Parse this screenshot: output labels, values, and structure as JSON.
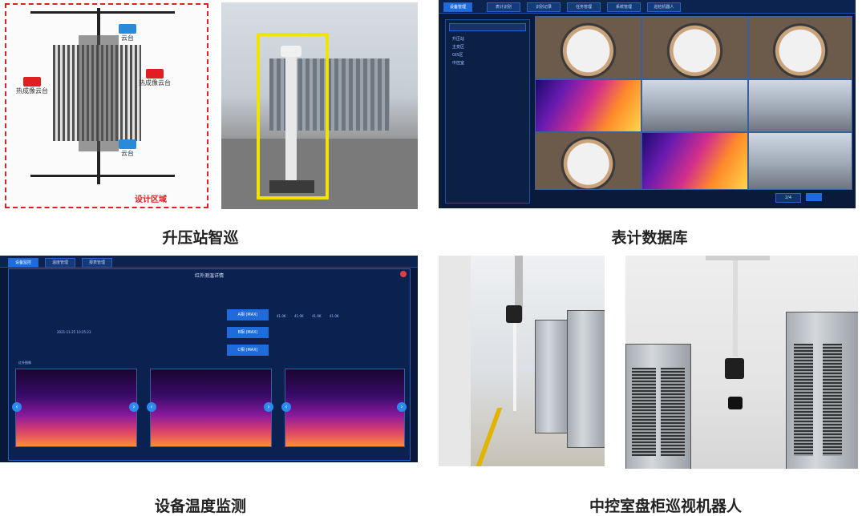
{
  "captions": {
    "booster": "升压站智巡",
    "meter_db": "表计数据库",
    "temp_monitor": "设备温度监测",
    "control_robot": "中控室盘柜巡视机器人"
  },
  "design_panel": {
    "region_label": "设计区域",
    "cam_label": "热成像云台",
    "cam_label_short": "云台"
  },
  "meter_panel": {
    "tabs": [
      "设备管理",
      "表计识别",
      "识别记录",
      "任务管理",
      "系统管理",
      "巡检机器人"
    ],
    "tree": [
      "升压站",
      "主变区",
      "GIS区",
      "中控室"
    ],
    "footer_value": "2/4"
  },
  "temp_panel": {
    "tabs": [
      "设备监控",
      "温度管理",
      "报表管理"
    ],
    "dialog_title": "红外测温详情",
    "phases": [
      "A相 (MAX)",
      "B相 (MAX)",
      "C相 (MAX)"
    ],
    "readings": [
      "41.0K",
      "41.0K",
      "41.0K",
      "41.0K"
    ],
    "date": "2021-11-25 10:25:23",
    "chart_caption": "红外图像"
  },
  "colors": {
    "accent_blue": "#1e6cdb",
    "dash_bg": "#0a1a3a",
    "caption": "#222222",
    "design_border": "#e02020"
  }
}
